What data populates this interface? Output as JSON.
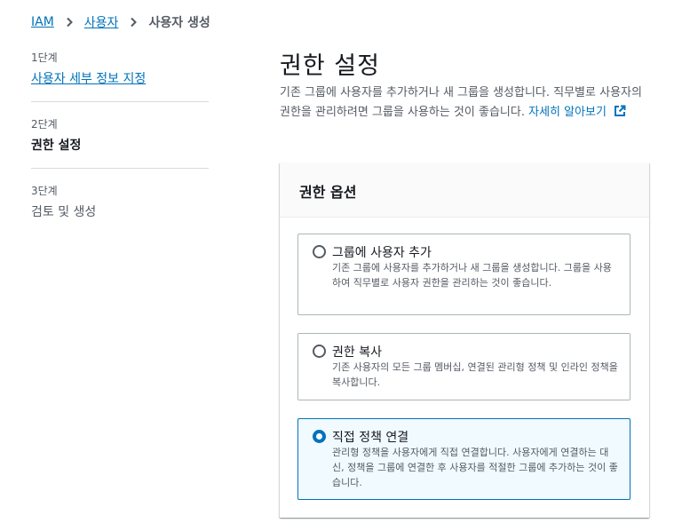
{
  "breadcrumb": {
    "items": [
      "IAM",
      "사용자"
    ],
    "current": "사용자 생성"
  },
  "steps": [
    {
      "num": "1단계",
      "title": "사용자 세부 정보 지정"
    },
    {
      "num": "2단계",
      "title": "권한 설정"
    },
    {
      "num": "3단계",
      "title": "검토 및 생성"
    }
  ],
  "main": {
    "title": "권한 설정",
    "description": "기존 그룹에 사용자를 추가하거나 새 그룹을 생성합니다. 직무별로 사용자의 권한을 관리하려면 그룹을 사용하는 것이 좋습니다.",
    "learn_more": "자세히 알아보기"
  },
  "panel": {
    "title": "권한 옵션",
    "options": [
      {
        "label": "그룹에 사용자 추가",
        "description": "기존 그룹에 사용자를 추가하거나 새 그룹을 생성합니다. 그룹을 사용하여 직무별로 사용자 권한을 관리하는 것이 좋습니다.",
        "selected": false
      },
      {
        "label": "권한 복사",
        "description": "기존 사용자의 모든 그룹 멤버십, 연결된 관리형 정책 및 인라인 정책을 복사합니다.",
        "selected": false
      },
      {
        "label": "직접 정책 연결",
        "description": "관리형 정책을 사용자에게 직접 연결합니다. 사용자에게 연결하는 대신, 정책을 그룹에 연결한 후 사용자를 적절한 그룹에 추가하는 것이 좋습니다.",
        "selected": true
      }
    ]
  },
  "colors": {
    "link": "#0073bb",
    "text": "#16191f",
    "muted": "#545b64",
    "selected_bg": "#f1faff"
  },
  "icons": {
    "breadcrumb_separator": "chevron-right-icon",
    "external_link": "external-link-icon"
  }
}
